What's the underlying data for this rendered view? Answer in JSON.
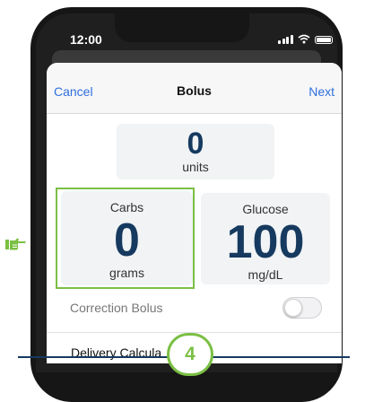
{
  "status_bar": {
    "time": "12:00"
  },
  "navbar": {
    "cancel_label": "Cancel",
    "title": "Bolus",
    "next_label": "Next"
  },
  "units_card": {
    "value": "0",
    "label": "units"
  },
  "carbs_card": {
    "label": "Carbs",
    "value": "0",
    "unit": "grams"
  },
  "glucose_card": {
    "label": "Glucose",
    "value": "100",
    "unit": "mg/dL"
  },
  "correction_bolus": {
    "label": "Correction Bolus",
    "enabled": false
  },
  "delivery_calculation": {
    "label": "Delivery Calcula"
  },
  "annotation": {
    "step_number": "4",
    "pointer_icon": "pointing-hand-icon"
  },
  "colors": {
    "accent_blue": "#2f6fde",
    "value_navy": "#163a5f",
    "highlight_green": "#7bbf44",
    "card_gray": "#f1f3f5"
  }
}
